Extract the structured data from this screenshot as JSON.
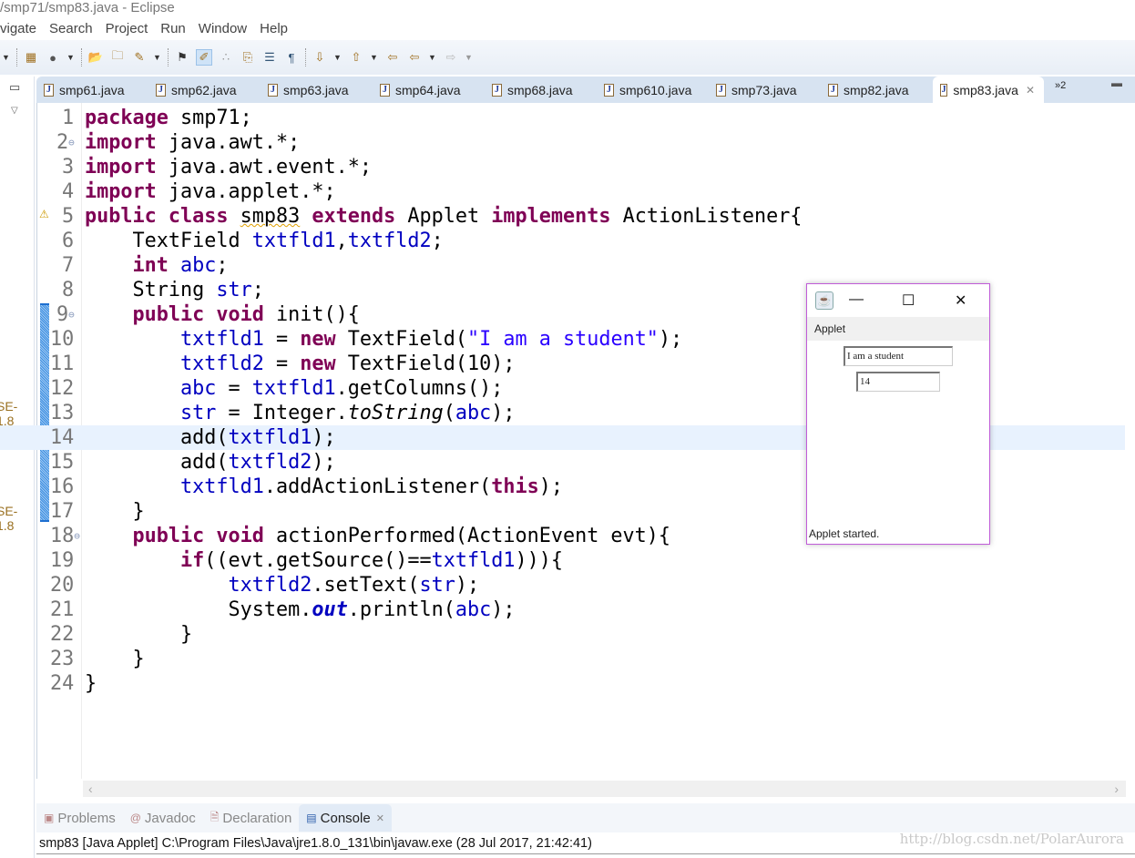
{
  "window": {
    "title": "/smp71/smp83.java - Eclipse"
  },
  "menu": [
    "vigate",
    "Search",
    "Project",
    "Run",
    "Window",
    "Help"
  ],
  "sidebar": {
    "labels": [
      "SE-1.8",
      "SE-1.8"
    ]
  },
  "tabs": [
    {
      "label": "smp61.java"
    },
    {
      "label": "smp62.java"
    },
    {
      "label": "smp63.java"
    },
    {
      "label": "smp64.java"
    },
    {
      "label": "smp68.java"
    },
    {
      "label": "smp610.java"
    },
    {
      "label": "smp73.java"
    },
    {
      "label": "smp82.java"
    },
    {
      "label": "smp83.java",
      "active": true
    }
  ],
  "tabs_overflow": "»2",
  "editor": {
    "highlighted_line": 14,
    "lines": [
      [
        [
          "kw",
          "package"
        ],
        [
          "p",
          " smp71;"
        ]
      ],
      [
        [
          "kw",
          "import"
        ],
        [
          "p",
          " java.awt.*;"
        ]
      ],
      [
        [
          "kw",
          "import"
        ],
        [
          "p",
          " java.awt.event.*;"
        ]
      ],
      [
        [
          "kw",
          "import"
        ],
        [
          "p",
          " java.applet.*;"
        ]
      ],
      [
        [
          "kw",
          "public"
        ],
        [
          "p",
          " "
        ],
        [
          "kw",
          "class"
        ],
        [
          "p",
          " "
        ],
        [
          "sq",
          "smp83"
        ],
        [
          "p",
          " "
        ],
        [
          "kw",
          "extends"
        ],
        [
          "p",
          " Applet "
        ],
        [
          "kw",
          "implements"
        ],
        [
          "p",
          " ActionListener{"
        ]
      ],
      [
        [
          "p",
          "    TextField "
        ],
        [
          "fd",
          "txtfld1"
        ],
        [
          "p",
          ","
        ],
        [
          "fd",
          "txtfld2"
        ],
        [
          "p",
          ";"
        ]
      ],
      [
        [
          "p",
          "    "
        ],
        [
          "kw",
          "int"
        ],
        [
          "p",
          " "
        ],
        [
          "fd",
          "abc"
        ],
        [
          "p",
          ";"
        ]
      ],
      [
        [
          "p",
          "    String "
        ],
        [
          "fd",
          "str"
        ],
        [
          "p",
          ";"
        ]
      ],
      [
        [
          "p",
          "    "
        ],
        [
          "kw",
          "public"
        ],
        [
          "p",
          " "
        ],
        [
          "kw",
          "void"
        ],
        [
          "p",
          " init(){"
        ]
      ],
      [
        [
          "p",
          "        "
        ],
        [
          "fd",
          "txtfld1"
        ],
        [
          "p",
          " = "
        ],
        [
          "kw",
          "new"
        ],
        [
          "p",
          " TextField("
        ],
        [
          "st",
          "\"I am a student\""
        ],
        [
          "p",
          ");"
        ]
      ],
      [
        [
          "p",
          "        "
        ],
        [
          "fd",
          "txtfld2"
        ],
        [
          "p",
          " = "
        ],
        [
          "kw",
          "new"
        ],
        [
          "p",
          " TextField(10);"
        ]
      ],
      [
        [
          "p",
          "        "
        ],
        [
          "fd",
          "abc"
        ],
        [
          "p",
          " = "
        ],
        [
          "fd",
          "txtfld1"
        ],
        [
          "p",
          ".getColumns();"
        ]
      ],
      [
        [
          "p",
          "        "
        ],
        [
          "fd",
          "str"
        ],
        [
          "p",
          " = Integer."
        ],
        [
          "it",
          "toString"
        ],
        [
          "p",
          "("
        ],
        [
          "fd",
          "abc"
        ],
        [
          "p",
          ");"
        ]
      ],
      [
        [
          "p",
          "        add("
        ],
        [
          "fd",
          "txtfld1"
        ],
        [
          "p",
          ");"
        ]
      ],
      [
        [
          "p",
          "        add("
        ],
        [
          "fd",
          "txtfld2"
        ],
        [
          "p",
          ");"
        ]
      ],
      [
        [
          "p",
          "        "
        ],
        [
          "fd",
          "txtfld1"
        ],
        [
          "p",
          ".addActionListener("
        ],
        [
          "kw",
          "this"
        ],
        [
          "p",
          ");"
        ]
      ],
      [
        [
          "p",
          "    }"
        ]
      ],
      [
        [
          "p",
          "    "
        ],
        [
          "kw",
          "public"
        ],
        [
          "p",
          " "
        ],
        [
          "kw",
          "void"
        ],
        [
          "p",
          " actionPerformed(ActionEvent evt){"
        ]
      ],
      [
        [
          "p",
          "        "
        ],
        [
          "kw",
          "if"
        ],
        [
          "p",
          "((evt.getSource()=="
        ],
        [
          "fd",
          "txtfld1"
        ],
        [
          "p",
          "))){"
        ]
      ],
      [
        [
          "p",
          "            "
        ],
        [
          "fd",
          "txtfld2"
        ],
        [
          "p",
          ".setText("
        ],
        [
          "fd",
          "str"
        ],
        [
          "p",
          ");"
        ]
      ],
      [
        [
          "p",
          "            System."
        ],
        [
          "sf",
          "out"
        ],
        [
          "p",
          ".println("
        ],
        [
          "fd",
          "abc"
        ],
        [
          "p",
          ");"
        ]
      ],
      [
        [
          "p",
          "        }"
        ]
      ],
      [
        [
          "p",
          "    }"
        ]
      ],
      [
        [
          "p",
          "}"
        ]
      ]
    ]
  },
  "bottom_tabs": [
    {
      "label": "Problems",
      "icon": "problems-icon"
    },
    {
      "label": "Javadoc",
      "icon": "at-icon"
    },
    {
      "label": "Declaration",
      "icon": "declaration-icon"
    },
    {
      "label": "Console",
      "icon": "console-icon",
      "active": true
    }
  ],
  "console": {
    "text": "smp83 [Java Applet] C:\\Program Files\\Java\\jre1.8.0_131\\bin\\javaw.exe (28 Jul 2017, 21:42:41)"
  },
  "watermark": "http://blog.csdn.net/PolarAurora",
  "applet": {
    "menu": "Applet",
    "field1": "I am a student",
    "field2": "14",
    "status": "Applet started."
  },
  "colors": {
    "keyword": "#7f0055",
    "field": "#0000c0",
    "string": "#2a00ff",
    "applet_border": "#c05cd8"
  }
}
